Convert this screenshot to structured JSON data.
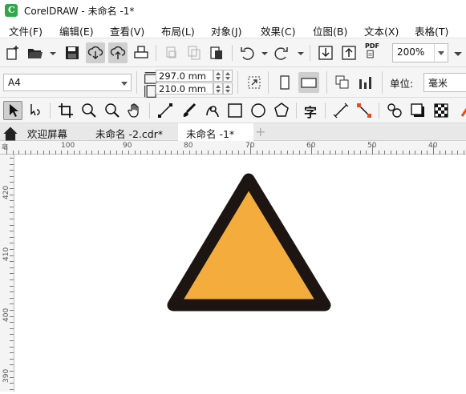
{
  "window": {
    "title": "CorelDRAW - 未命名 -1*",
    "logo_letter": "C"
  },
  "menu": [
    "文件(F)",
    "编辑(E)",
    "查看(V)",
    "布局(L)",
    "对象(J)",
    "效果(C)",
    "位图(B)",
    "文本(X)",
    "表格(T)"
  ],
  "toolbar": {
    "zoom": "200%",
    "pdf_label": "PDF"
  },
  "properties": {
    "page_size": "A4",
    "width": "297.0 mm",
    "height": "210.0 mm",
    "units_label": "单位:",
    "units_value": "毫米"
  },
  "tools": {
    "text_tool_glyph": "字"
  },
  "tabs": [
    {
      "label": "欢迎屏幕",
      "active": false
    },
    {
      "label": "未命名 -2.cdr*",
      "active": false
    },
    {
      "label": "未命名 -1*",
      "active": true
    }
  ],
  "ruler": {
    "unit_label": "亳",
    "h_labels": [
      "100",
      "90",
      "80",
      "70",
      "60",
      "50",
      "40"
    ],
    "v_labels": [
      "420",
      "410",
      "400",
      "390"
    ]
  },
  "shape": {
    "type": "triangle",
    "fill": "#f4ad3c",
    "outline": "#1c1512"
  },
  "colors": {
    "accent_green": "#2ea84a",
    "active_tab": "#ffffff"
  }
}
